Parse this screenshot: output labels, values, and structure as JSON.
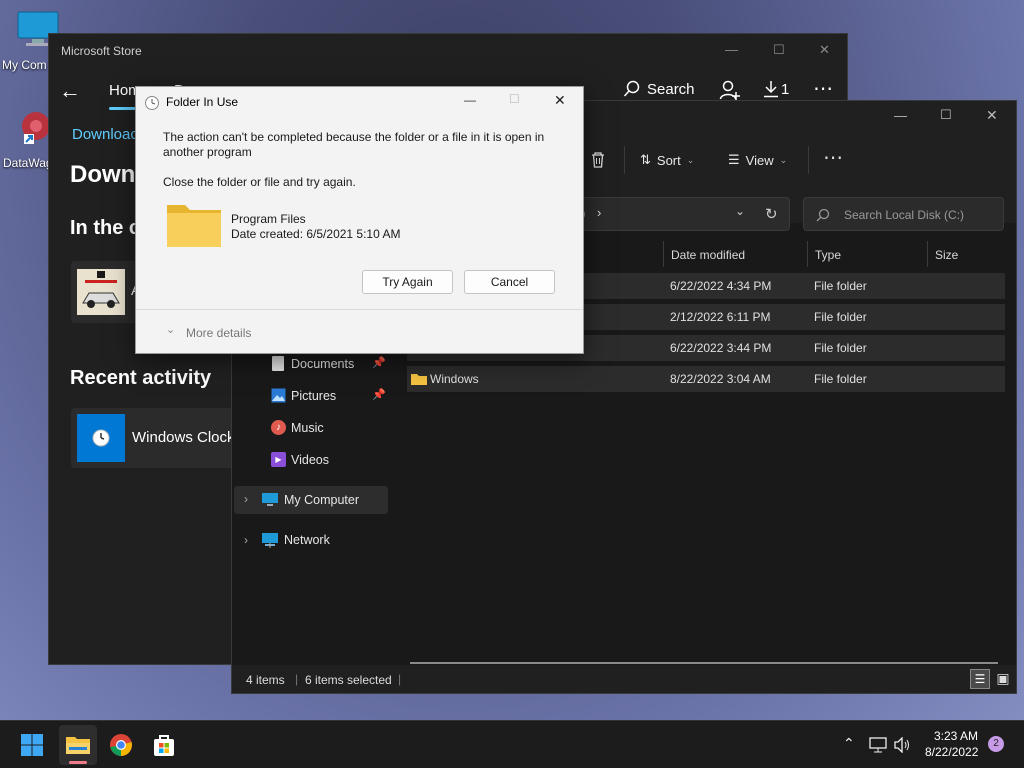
{
  "desktop": {
    "icons": [
      {
        "label": "My Com"
      },
      {
        "label": "DataWag"
      }
    ]
  },
  "store": {
    "title": "Microsoft Store",
    "nav_home": "Hom",
    "nav_second": "Dc",
    "search_label": "Search",
    "downloads_count": "1",
    "downloads_link": "Downloac",
    "page_heading": "Down",
    "section_in_the": "In the c",
    "app_row_letter": "A",
    "recent_activity": "Recent activity",
    "recent_item": "Windows Clock"
  },
  "explorer": {
    "toolbar": {
      "sort": "Sort",
      "view": "View"
    },
    "address_tail": ")",
    "search_placeholder": "Search Local Disk (C:)",
    "columns": {
      "date": "Date modified",
      "type": "Type",
      "size": "Size"
    },
    "rows": [
      {
        "name": "",
        "date": "6/22/2022 4:34 PM",
        "type": "File folder"
      },
      {
        "name": "",
        "date": "2/12/2022 6:11 PM",
        "type": "File folder"
      },
      {
        "name": "",
        "date": "6/22/2022 3:44 PM",
        "type": "File folder"
      },
      {
        "name": "Windows",
        "date": "8/22/2022 3:04 AM",
        "type": "File folder"
      }
    ],
    "sidebar": {
      "documents": "Documents",
      "pictures": "Pictures",
      "music": "Music",
      "videos": "Videos",
      "my_computer": "My Computer",
      "network": "Network"
    },
    "status": {
      "items": "4 items",
      "selected": "6 items selected"
    }
  },
  "dialog": {
    "title": "Folder In Use",
    "message_line1": "The action can't be completed because the folder or a file in it is open in",
    "message_line2": "another program",
    "instruction": "Close the folder or file and try again.",
    "file_name": "Program Files",
    "file_date": "Date created: 6/5/2021 5:10 AM",
    "try_again": "Try Again",
    "cancel": "Cancel",
    "more_details": "More details"
  },
  "taskbar": {
    "time": "3:23 AM",
    "date": "8/22/2022",
    "notification_count": "2"
  },
  "colors": {
    "accent": "#0078d4",
    "folder": "#f5c242",
    "dark_window": "#202020",
    "dialog_bg": "#f3f3f3"
  }
}
